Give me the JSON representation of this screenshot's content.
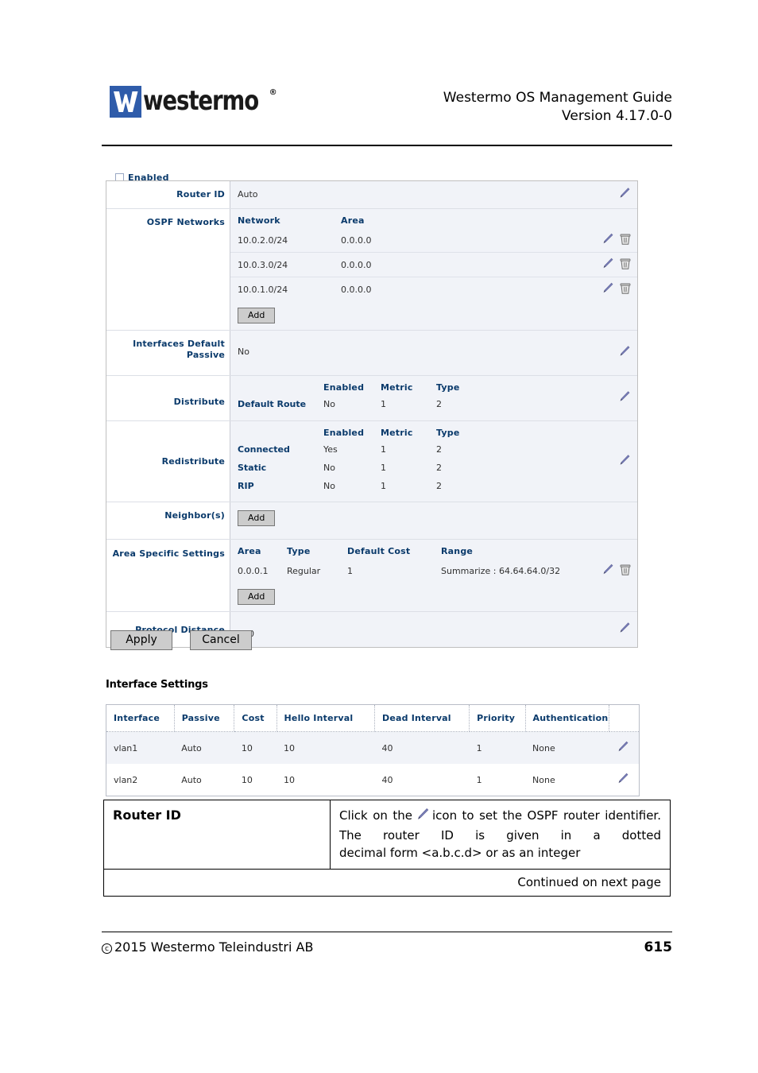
{
  "header": {
    "logo_text": "westermo",
    "logo_registered": "®",
    "title_line1": "Westermo OS Management Guide",
    "title_line2": "Version 4.17.0-0"
  },
  "clipped_row": {
    "label": "Enabled"
  },
  "panel": {
    "router_id": {
      "label": "Router ID",
      "value": "Auto"
    },
    "ospf_networks": {
      "label": "OSPF Networks",
      "columns": [
        "Network",
        "Area"
      ],
      "rows": [
        {
          "network": "10.0.2.0/24",
          "area": "0.0.0.0"
        },
        {
          "network": "10.0.3.0/24",
          "area": "0.0.0.0"
        },
        {
          "network": "10.0.1.0/24",
          "area": "0.0.0.0"
        }
      ],
      "add_label": "Add"
    },
    "interfaces_default_passive": {
      "label_line1": "Interfaces Default",
      "label_line2": "Passive",
      "value": "No"
    },
    "distribute": {
      "label": "Distribute",
      "columns": [
        "",
        "Enabled",
        "Metric",
        "Type"
      ],
      "rows": [
        {
          "name": "Default Route",
          "enabled": "No",
          "metric": "1",
          "type": "2"
        }
      ]
    },
    "redistribute": {
      "label": "Redistribute",
      "columns": [
        "",
        "Enabled",
        "Metric",
        "Type"
      ],
      "rows": [
        {
          "name": "Connected",
          "enabled": "Yes",
          "metric": "1",
          "type": "2"
        },
        {
          "name": "Static",
          "enabled": "No",
          "metric": "1",
          "type": "2"
        },
        {
          "name": "RIP",
          "enabled": "No",
          "metric": "1",
          "type": "2"
        }
      ]
    },
    "neighbors": {
      "label": "Neighbor(s)",
      "add_label": "Add"
    },
    "area_specific_settings": {
      "label": "Area Specific Settings",
      "columns": [
        "Area",
        "Type",
        "Default Cost",
        "Range"
      ],
      "rows": [
        {
          "area": "0.0.0.1",
          "type": "Regular",
          "default_cost": "1",
          "range": "Summarize : 64.64.64.0/32"
        }
      ],
      "add_label": "Add"
    },
    "protocol_distance": {
      "label": "Protocol Distance",
      "value": "110"
    }
  },
  "form_buttons": {
    "apply": "Apply",
    "cancel": "Cancel"
  },
  "interface_settings": {
    "title": "Interface Settings",
    "columns": [
      "Interface",
      "Passive",
      "Cost",
      "Hello Interval",
      "Dead Interval",
      "Priority",
      "Authentication"
    ],
    "rows": [
      {
        "interface": "vlan1",
        "passive": "Auto",
        "cost": "10",
        "hello_interval": "10",
        "dead_interval": "40",
        "priority": "1",
        "authentication": "None"
      },
      {
        "interface": "vlan2",
        "passive": "Auto",
        "cost": "10",
        "hello_interval": "10",
        "dead_interval": "40",
        "priority": "1",
        "authentication": "None"
      }
    ]
  },
  "description": {
    "term": "Router ID",
    "text_before_icon": "Click on the",
    "text_after_icon": "icon to set the OSPF router identifier.  The router ID is given in a dotted",
    "text_lastline": "decimal form <a.b.c.d> or as an integer",
    "continued": "Continued on next page"
  },
  "footer": {
    "copyright_symbol": "c",
    "copyright": "2015 Westermo Teleindustri AB",
    "page": "615"
  },
  "colors": {
    "label_blue": "#0a3a6b",
    "value_bg": "#f1f3f8",
    "logo_blue": "#2f5caa",
    "pencil": "#7b80bb",
    "trash": "#8a8a8a"
  }
}
